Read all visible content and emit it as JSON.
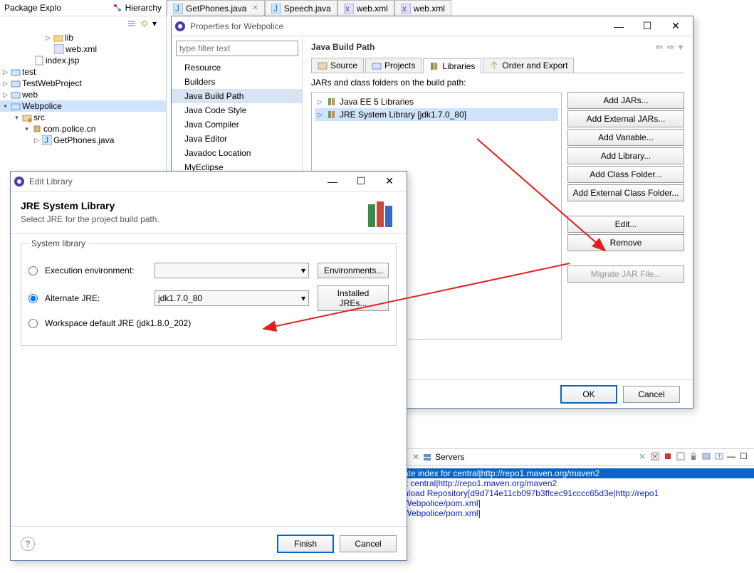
{
  "editor_tabs": [
    "GetPhones.java",
    "Speech.java",
    "web.xml",
    "web.xml"
  ],
  "pkg_explorer": {
    "title": "Package Explo",
    "hierarchy_tab": "Hierarchy",
    "tree": {
      "lib": "lib",
      "webxml": "web.xml",
      "indexjsp": "index.jsp",
      "test": "test",
      "testwebproject": "TestWebProject",
      "web": "web",
      "webpolice": "Webpolice",
      "src": "src",
      "compolice": "com.police.cn",
      "getphones": "GetPhones.java"
    }
  },
  "props_dialog": {
    "title": "Properties for Webpolice",
    "filter_placeholder": "type filter text",
    "items": [
      "Resource",
      "Builders",
      "Java Build Path",
      "Java Code Style",
      "Java Compiler",
      "Java Editor",
      "Javadoc Location",
      "MyEclipse"
    ],
    "section": "Java Build Path",
    "tabs": [
      "Source",
      "Projects",
      "Libraries",
      "Order and Export"
    ],
    "jars_label": "JARs and class folders on the build path:",
    "jars": [
      "Java EE 5 Libraries",
      "JRE System Library [jdk1.7.0_80]"
    ],
    "buttons": [
      "Add JARs...",
      "Add External JARs...",
      "Add Variable...",
      "Add Library...",
      "Add Class Folder...",
      "Add External Class Folder...",
      "Edit...",
      "Remove",
      "Migrate JAR File..."
    ],
    "ok": "OK",
    "cancel": "Cancel"
  },
  "edit_dialog": {
    "title": "Edit Library",
    "heading": "JRE System Library",
    "sub": "Select JRE for the project build path.",
    "group": "System library",
    "exec_env": "Execution environment:",
    "alt_jre": "Alternate JRE:",
    "alt_jre_value": "jdk1.7.0_80",
    "workspace_default": "Workspace default JRE (jdk1.8.0_202)",
    "env_btn": "Environments...",
    "installed_btn": "Installed JREs...",
    "finish": "Finish",
    "cancel": "Cancel"
  },
  "bottom": {
    "servers_tab": "Servers",
    "lines": [
      "ate index for central|http://repo1.maven.org/maven2",
      "k central|http://repo1.maven.org/maven2",
      "nload Repository[d9d714e11cb097b3ffcec91cccc65d3e|http://repo1",
      "Webpolice/pom.xml]",
      "Webpolice/pom.xml]"
    ]
  }
}
